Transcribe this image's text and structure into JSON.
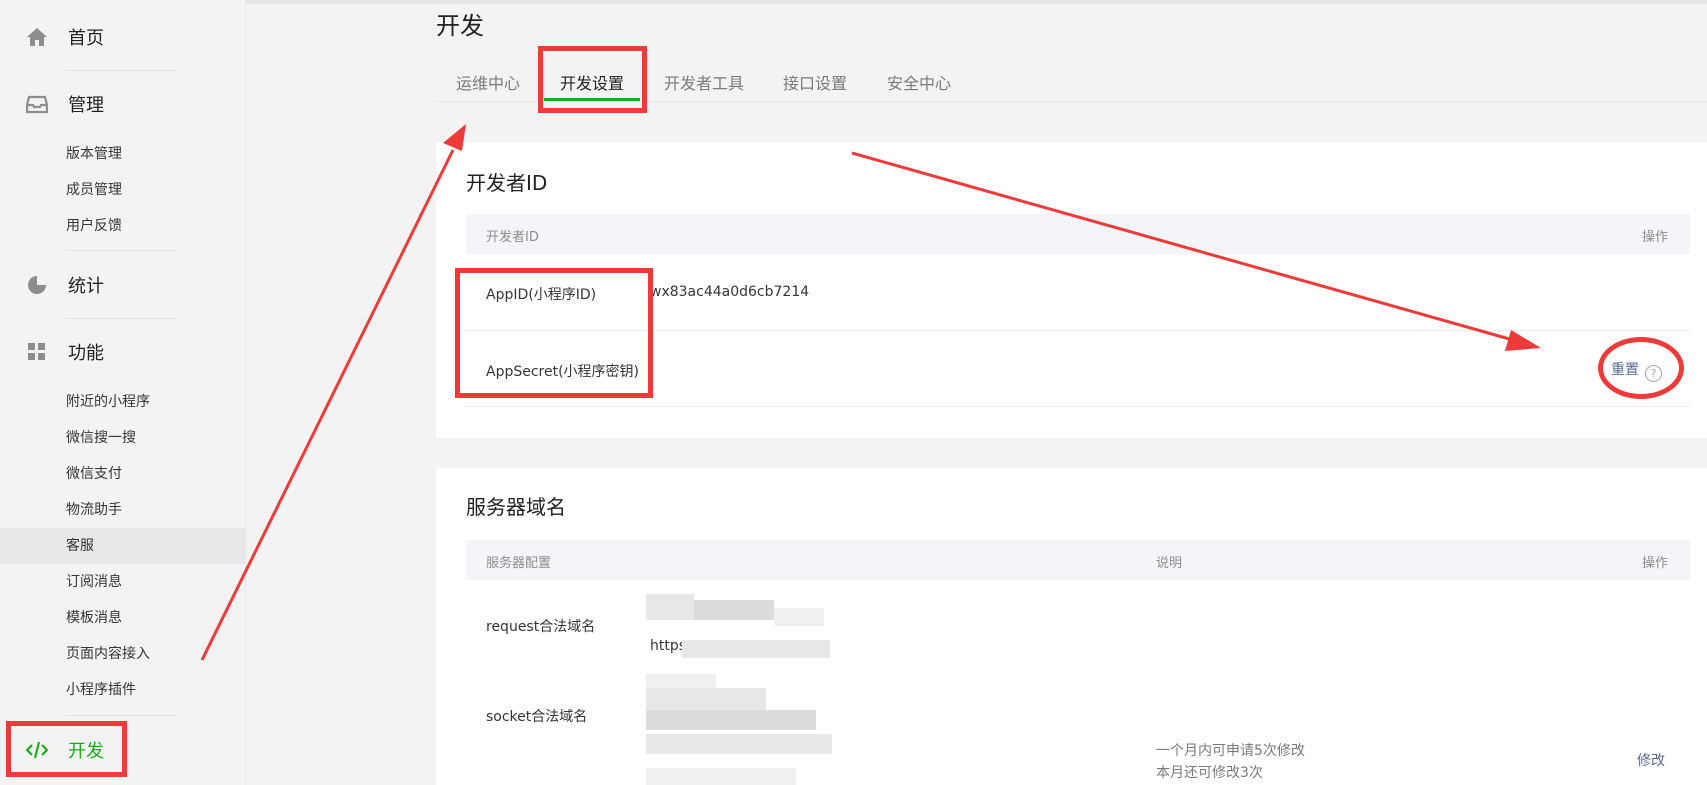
{
  "sidebar": {
    "home": {
      "label": "首页",
      "icon": "home-icon"
    },
    "manage": {
      "label": "管理",
      "icon": "inbox-icon",
      "items": [
        "版本管理",
        "成员管理",
        "用户反馈"
      ]
    },
    "stats": {
      "label": "统计",
      "icon": "pie-chart-icon"
    },
    "features": {
      "label": "功能",
      "icon": "grid-icon",
      "items": [
        "附近的小程序",
        "微信搜一搜",
        "微信支付",
        "物流助手",
        "客服",
        "订阅消息",
        "模板消息",
        "页面内容接入",
        "小程序插件"
      ]
    },
    "dev": {
      "label": "开发",
      "icon": "code-icon"
    }
  },
  "page": {
    "title": "开发",
    "tabs": [
      "运维中心",
      "开发设置",
      "开发者工具",
      "接口设置",
      "安全中心"
    ],
    "active_tab": "开发设置"
  },
  "developer_id": {
    "title": "开发者ID",
    "header_col1": "开发者ID",
    "header_col2": "操作",
    "appid_label": "AppID(小程序ID)",
    "appid_value": "wx83ac44a0d6cb7214",
    "secret_label": "AppSecret(小程序密钥)",
    "reset_label": "重置",
    "help_glyph": "?"
  },
  "server_domain": {
    "title": "服务器域名",
    "header_col1": "服务器配置",
    "header_col2": "说明",
    "header_col3": "操作",
    "request_label": "request合法域名",
    "request_prefix": "https:",
    "socket_label": "socket合法域名",
    "note1": "一个月内可申请5次修改",
    "note2": "本月还可修改3次",
    "modify_label": "修改"
  },
  "colors": {
    "accent": "#1aad19",
    "annotation": "#ef3a3a",
    "link": "#576b95"
  }
}
